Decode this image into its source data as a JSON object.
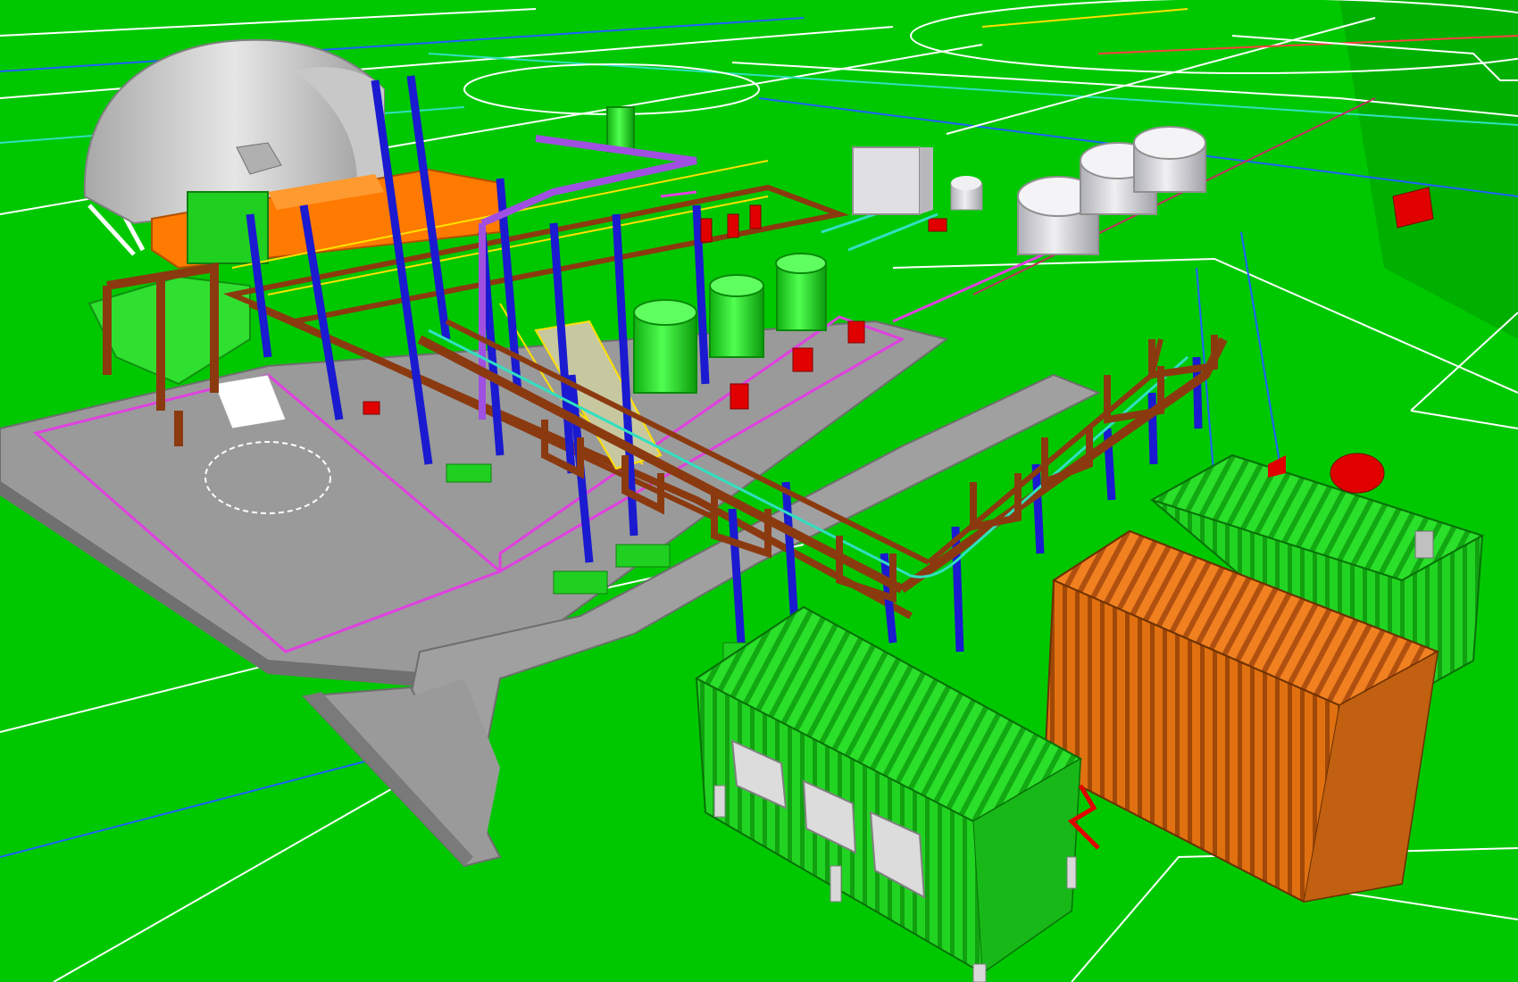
{
  "scene": {
    "colors": {
      "ground": "#00c800",
      "ground_dark": "#00b000",
      "slab": "#9a9a9a",
      "slab_edge": "#6e6e6e",
      "structure_blue": "#1a1ad0",
      "structure_brown": "#8b3a10",
      "orange": "#ff7a00",
      "container_green": "#22d422",
      "container_orange": "#e07010",
      "tank_grey": "#d8d8dc",
      "red": "#e00000",
      "magenta": "#e040e0",
      "purple": "#a050e0",
      "yellow": "#ffe000",
      "cyan": "#30e0c0",
      "white": "#ffffff"
    },
    "objects": {
      "shelter": "arched-shelter",
      "silos": "storage-silos",
      "containers": "shipping-containers",
      "pipe_rack": "pipe-rack"
    }
  }
}
